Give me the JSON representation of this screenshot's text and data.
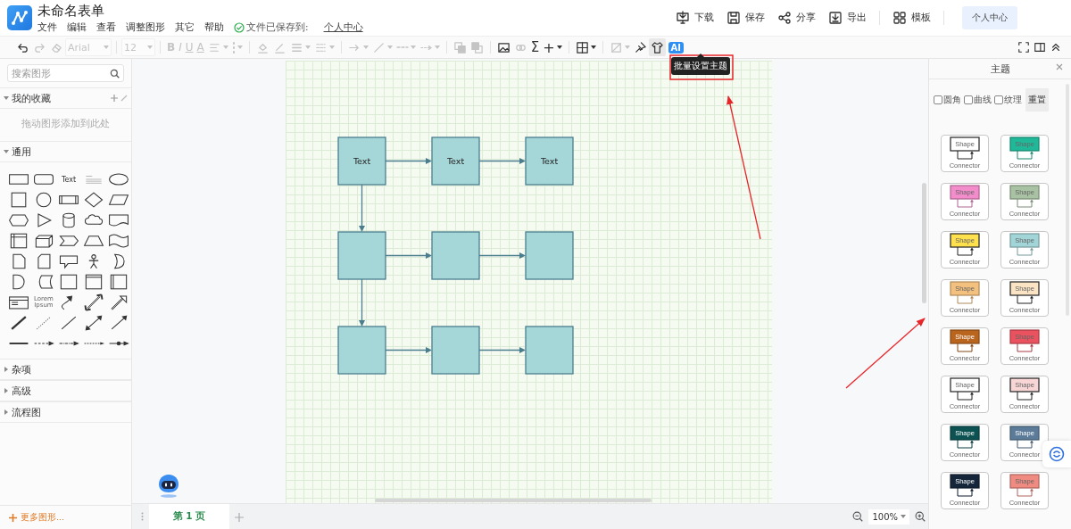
{
  "header": {
    "title": "未命名表单",
    "menus": [
      "文件",
      "编辑",
      "查看",
      "调整图形",
      "其它",
      "帮助"
    ],
    "save_status": "文件已保存到:",
    "save_location": "个人中心",
    "actions": [
      {
        "kind": "download",
        "label": "下载"
      },
      {
        "kind": "save",
        "label": "保存"
      },
      {
        "kind": "share",
        "label": "分享"
      },
      {
        "kind": "export",
        "label": "导出"
      },
      {
        "kind": "separator"
      },
      {
        "kind": "template",
        "label": "模板"
      },
      {
        "kind": "separator"
      }
    ],
    "account_button": "个人中心"
  },
  "toolbar": {
    "items": [
      {
        "kind": "undo",
        "disabled": false,
        "has_menu": false
      },
      {
        "kind": "redo",
        "disabled": true,
        "has_menu": false
      },
      {
        "kind": "eraser",
        "disabled": true,
        "has_menu": false
      },
      {
        "kind": "font-select",
        "label": "Arial",
        "disabled": true,
        "has_menu": true
      },
      {
        "kind": "separator"
      },
      {
        "kind": "size-select",
        "label": "12",
        "disabled": true,
        "has_menu": true
      },
      {
        "kind": "separator"
      },
      {
        "kind": "bold",
        "label": "B",
        "disabled": true,
        "has_menu": false
      },
      {
        "kind": "italic",
        "label": "I",
        "disabled": true,
        "has_menu": false
      },
      {
        "kind": "underline",
        "label": "U",
        "disabled": true,
        "has_menu": false
      },
      {
        "kind": "font-color",
        "label": "A",
        "disabled": true,
        "has_menu": false
      },
      {
        "kind": "align",
        "disabled": true,
        "has_menu": true
      },
      {
        "kind": "dots",
        "disabled": true,
        "has_menu": true
      },
      {
        "kind": "separator"
      },
      {
        "kind": "fill-color",
        "disabled": true,
        "has_menu": false
      },
      {
        "kind": "line-color",
        "disabled": true,
        "has_menu": false
      },
      {
        "kind": "line-width",
        "disabled": true,
        "has_menu": true
      },
      {
        "kind": "dash",
        "disabled": true,
        "has_menu": true
      },
      {
        "kind": "separator"
      },
      {
        "kind": "arrow",
        "disabled": true,
        "has_menu": true
      },
      {
        "kind": "line",
        "disabled": true,
        "has_menu": true
      },
      {
        "kind": "line-style",
        "disabled": true,
        "has_menu": true
      },
      {
        "kind": "line-end",
        "disabled": true,
        "has_menu": true
      },
      {
        "kind": "separator"
      },
      {
        "kind": "to-front",
        "disabled": true,
        "has_menu": false
      },
      {
        "kind": "to-back",
        "disabled": true,
        "has_menu": false
      },
      {
        "kind": "separator"
      },
      {
        "kind": "image",
        "disabled": false,
        "has_menu": false
      },
      {
        "kind": "link",
        "disabled": true,
        "has_menu": false
      },
      {
        "kind": "sigma",
        "label": "Σ",
        "disabled": false,
        "has_menu": false
      },
      {
        "kind": "plus",
        "label": "+",
        "disabled": false,
        "has_menu": true
      },
      {
        "kind": "separator"
      },
      {
        "kind": "table",
        "disabled": false,
        "has_menu": true
      },
      {
        "kind": "separator"
      },
      {
        "kind": "shape-style",
        "disabled": true,
        "has_menu": true
      },
      {
        "kind": "pin",
        "disabled": false,
        "has_menu": false
      },
      {
        "kind": "shirt",
        "disabled": false,
        "has_menu": false
      },
      {
        "kind": "ai",
        "label": "AI",
        "disabled": false,
        "has_menu": false
      }
    ],
    "right": [
      {
        "kind": "fullscreen"
      },
      {
        "kind": "panel"
      },
      {
        "kind": "collapse"
      }
    ],
    "tooltip": "批量设置主题"
  },
  "sidebar": {
    "search_placeholder": "搜索图形",
    "sections": [
      {
        "kind": "favorites",
        "title": "我的收藏",
        "expanded": true,
        "hint": "拖动图形添加到此处"
      },
      {
        "kind": "palette",
        "title": "通用",
        "expanded": true,
        "shapes": [
          {
            "kind": "rect"
          },
          {
            "kind": "rounded-rect"
          },
          {
            "kind": "text",
            "label": "Text"
          },
          {
            "kind": "heading"
          },
          {
            "kind": "ellipse"
          },
          {
            "kind": "square"
          },
          {
            "kind": "circle"
          },
          {
            "kind": "process"
          },
          {
            "kind": "diamond"
          },
          {
            "kind": "parallelogram"
          },
          {
            "kind": "hexagon"
          },
          {
            "kind": "triangle"
          },
          {
            "kind": "cylinder"
          },
          {
            "kind": "cloud"
          },
          {
            "kind": "document"
          },
          {
            "kind": "internal-storage"
          },
          {
            "kind": "cube"
          },
          {
            "kind": "step"
          },
          {
            "kind": "trapezoid"
          },
          {
            "kind": "tape"
          },
          {
            "kind": "note"
          },
          {
            "kind": "card"
          },
          {
            "kind": "callout"
          },
          {
            "kind": "actor"
          },
          {
            "kind": "or"
          },
          {
            "kind": "delay"
          },
          {
            "kind": "stored-data"
          },
          {
            "kind": "square2"
          },
          {
            "kind": "window"
          },
          {
            "kind": "container"
          },
          {
            "kind": "list"
          },
          {
            "kind": "textbox",
            "label": "Lorem Ipsum"
          },
          {
            "kind": "curved-arrow"
          },
          {
            "kind": "double-arrow"
          },
          {
            "kind": "single-arrow"
          },
          {
            "kind": "thick-line"
          },
          {
            "kind": "dashed-line"
          },
          {
            "kind": "line"
          },
          {
            "kind": "bidirectional"
          },
          {
            "kind": "directional"
          },
          {
            "kind": "h-thick"
          },
          {
            "kind": "h-dash-arrow"
          },
          {
            "kind": "h-dashdot-arrow"
          },
          {
            "kind": "h-dash-arrow2"
          },
          {
            "kind": "h-dot-arrow"
          }
        ]
      },
      {
        "kind": "group",
        "title": "杂项",
        "expanded": false
      },
      {
        "kind": "group",
        "title": "高级",
        "expanded": false
      },
      {
        "kind": "group",
        "title": "流程图",
        "expanded": false
      }
    ],
    "more_shapes": "更多图形..."
  },
  "canvas": {
    "rows": [
      {
        "nodes": [
          {
            "label": "Text",
            "arrow_right": true,
            "arrow_down": true
          },
          {
            "label": "Text",
            "arrow_right": true,
            "arrow_down": false
          },
          {
            "label": "Text",
            "arrow_right": false,
            "arrow_down": false
          }
        ]
      },
      {
        "nodes": [
          {
            "arrow_right": true,
            "arrow_down": true
          },
          {
            "arrow_right": true,
            "arrow_down": false
          },
          {
            "arrow_right": false,
            "arrow_down": false
          }
        ]
      },
      {
        "nodes": [
          {
            "arrow_right": true,
            "arrow_down": false
          },
          {
            "arrow_right": true,
            "arrow_down": false
          },
          {
            "arrow_right": false,
            "arrow_down": false
          }
        ]
      }
    ],
    "pages": [
      {
        "label": "第 1 页",
        "selected": true
      }
    ],
    "zoom": "100%"
  },
  "theme_panel": {
    "title": "主题",
    "options": [
      {
        "label": "圆角",
        "checked": false
      },
      {
        "label": "曲线",
        "checked": false
      },
      {
        "label": "纹理",
        "checked": false
      }
    ],
    "reset": "重置",
    "themes": [
      {
        "color": "#ffffff",
        "shape_text": "Shape",
        "connector_text": "Connector"
      },
      {
        "color": "#1fb99a",
        "shape_text": "Shape",
        "connector_text": "Connector"
      },
      {
        "color": "#f28ccb",
        "shape_text": "Shape",
        "connector_text": "Connector"
      },
      {
        "color": "#a9c2a3",
        "shape_text": "Shape",
        "connector_text": "Connector"
      },
      {
        "color": "#ffe04d",
        "shape_text": "Shape",
        "connector_text": "Connector"
      },
      {
        "color": "#a2d5d7",
        "shape_text": "Shape",
        "connector_text": "Connector"
      },
      {
        "color": "#f4c07e",
        "shape_text": "Shape",
        "connector_text": "Connector"
      },
      {
        "color": "#fae4c4",
        "shape_text": "Shape",
        "connector_text": "Connector"
      },
      {
        "color": "#b9651e",
        "shape_text": "Shape",
        "connector_text": "Connector"
      },
      {
        "color": "#e9525e",
        "shape_text": "Shape",
        "connector_text": "Connector"
      },
      {
        "color": "#fefefe",
        "shape_text": "Shape",
        "connector_text": "Connector"
      },
      {
        "color": "#f8d6d6",
        "shape_text": "Shape",
        "connector_text": "Connector"
      },
      {
        "color": "#0d5253",
        "shape_text": "Shape",
        "connector_text": "Connector"
      },
      {
        "color": "#5b7b99",
        "shape_text": "Shape",
        "connector_text": "Connector"
      },
      {
        "color": "#15263b",
        "shape_text": "Shape",
        "connector_text": "Connector"
      },
      {
        "color": "#f08b82",
        "shape_text": "Shape",
        "connector_text": "Connector"
      }
    ]
  }
}
